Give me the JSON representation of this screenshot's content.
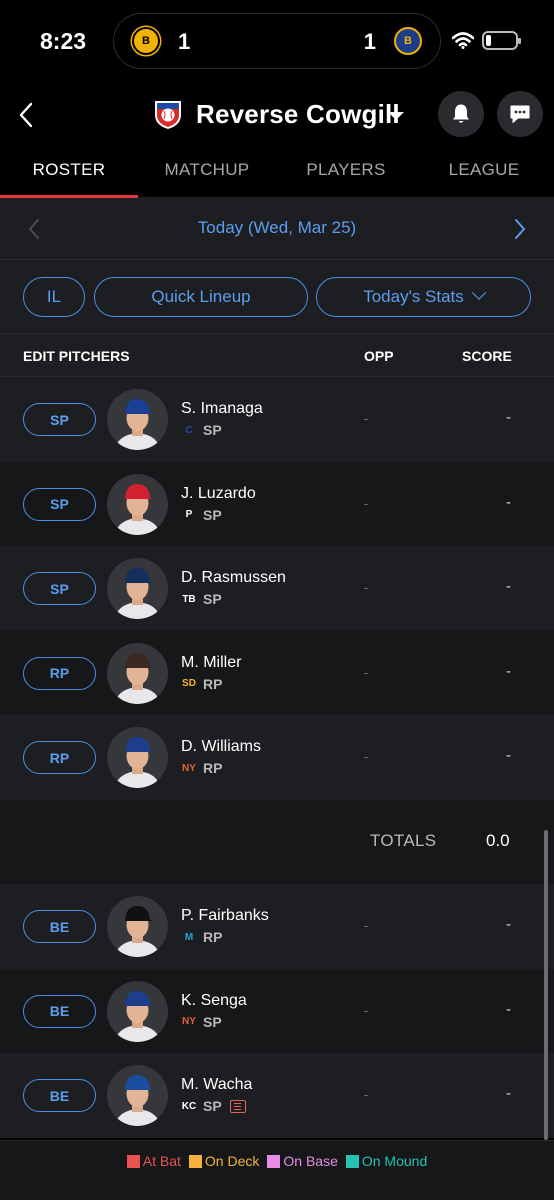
{
  "status_bar": {
    "time": "8:23",
    "live_game": {
      "away_logo": "bruins-logo",
      "away_abbr": "B",
      "away_score": "1",
      "home_score": "1",
      "home_logo": "sabres-logo",
      "home_abbr": "B"
    },
    "icons": [
      "wifi-icon",
      "battery-icon"
    ]
  },
  "header": {
    "team_name": "Reverse Cowgill",
    "icons": [
      "back-chevron-icon",
      "team-logo",
      "dropdown-caret-icon",
      "bell-icon",
      "chat-icon"
    ]
  },
  "tabs": [
    {
      "label": "ROSTER",
      "active": true
    },
    {
      "label": "MATCHUP",
      "active": false
    },
    {
      "label": "PLAYERS",
      "active": false
    },
    {
      "label": "LEAGUE",
      "active": false
    }
  ],
  "date_nav": {
    "label": "Today (Wed, Mar 25)"
  },
  "filters": {
    "il": "IL",
    "quick_lineup": "Quick Lineup",
    "stats": "Today's Stats"
  },
  "columns": {
    "edit": "EDIT PITCHERS",
    "opp": "OPP",
    "score": "SCORE"
  },
  "players": [
    {
      "slot": "SP",
      "name": "S. Imanaga",
      "pos": "SP",
      "team_logo": "cubs-logo",
      "team_mark": "C",
      "team_color": "#1f4aa8",
      "cap": "#1b3f94",
      "opp": "-",
      "score": "-"
    },
    {
      "slot": "SP",
      "name": "J. Luzardo",
      "pos": "SP",
      "team_logo": "phillies-logo",
      "team_mark": "P",
      "team_color": "#ffffff",
      "cap": "#d22030",
      "opp": "-",
      "score": "-"
    },
    {
      "slot": "SP",
      "name": "D. Rasmussen",
      "pos": "SP",
      "team_logo": "rays-logo",
      "team_mark": "TB",
      "team_color": "#ffffff",
      "cap": "#142f5c",
      "opp": "-",
      "score": "-"
    },
    {
      "slot": "RP",
      "name": "M. Miller",
      "pos": "RP",
      "team_logo": "padres-logo",
      "team_mark": "SD",
      "team_color": "#f2b51b",
      "cap": "#3b2a1f",
      "opp": "-",
      "score": "-"
    },
    {
      "slot": "RP",
      "name": "D. Williams",
      "pos": "RP",
      "team_logo": "mets-logo",
      "team_mark": "NY",
      "team_color": "#e0643a",
      "cap": "#1d3e8c",
      "opp": "-",
      "score": "-"
    }
  ],
  "totals": {
    "label": "TOTALS",
    "value": "0.0"
  },
  "bench": [
    {
      "slot": "BE",
      "name": "P. Fairbanks",
      "pos": "RP",
      "team_logo": "marlins-logo",
      "team_mark": "M",
      "team_color": "#1ea6d9",
      "cap": "#111111",
      "opp": "-",
      "score": "-"
    },
    {
      "slot": "BE",
      "name": "K. Senga",
      "pos": "SP",
      "team_logo": "mets-logo",
      "team_mark": "NY",
      "team_color": "#e0643a",
      "cap": "#1d3e8c",
      "opp": "-",
      "score": "-"
    },
    {
      "slot": "BE",
      "name": "M. Wacha",
      "pos": "SP",
      "team_logo": "royals-logo",
      "team_mark": "KC",
      "team_color": "#ffffff",
      "cap": "#1b4e9e",
      "opp": "-",
      "score": "-",
      "news": true
    }
  ],
  "legend": [
    {
      "label": "At Bat",
      "color": "#e8554e"
    },
    {
      "label": "On Deck",
      "color": "#f5b23d"
    },
    {
      "label": "On Base",
      "color": "#e88ce8"
    },
    {
      "label": "On Mound",
      "color": "#27c2b3"
    }
  ],
  "colors": {
    "accent": "#5b9eef",
    "tab_underline": "#e6393f",
    "background": "#000000",
    "row_light": "#1d1e21",
    "row_dark": "#161719"
  }
}
